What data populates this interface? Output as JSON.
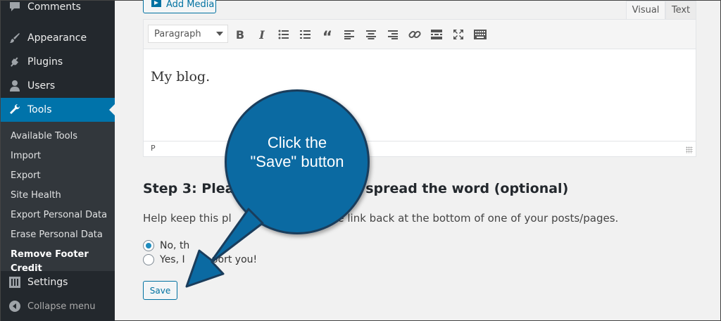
{
  "sidebar": {
    "items": [
      {
        "label": "Comments",
        "icon": "comment-icon"
      },
      {
        "label": "Appearance",
        "icon": "paintbrush-icon"
      },
      {
        "label": "Plugins",
        "icon": "plugin-icon"
      },
      {
        "label": "Users",
        "icon": "user-icon"
      },
      {
        "label": "Tools",
        "icon": "wrench-icon",
        "active": true
      },
      {
        "label": "Settings",
        "icon": "settings-icon"
      }
    ],
    "submenu": [
      "Available Tools",
      "Import",
      "Export",
      "Site Health",
      "Export Personal Data",
      "Erase Personal Data",
      "Remove Footer Credit"
    ],
    "collapse_label": "Collapse menu"
  },
  "editor": {
    "add_media_label": "Add Media",
    "tab_visual": "Visual",
    "tab_text": "Text",
    "format_value": "Paragraph",
    "content": "My blog.",
    "status_path": "P"
  },
  "step3": {
    "heading_left": "Step 3: Please",
    "heading_right": "and spread the word (optional)",
    "help_left": "Help keep this pl",
    "help_right": "one link back at the bottom of one of your posts/pages.",
    "option_no": "No, th",
    "option_yes_left": "Yes, I",
    "option_yes_right": "port you!",
    "save_label": "Save"
  },
  "callout": {
    "text": "Click the \"Save\" button"
  },
  "colors": {
    "sidebar_bg": "#23282d",
    "active_blue": "#0073aa",
    "callout_blue": "#0b6aa2"
  }
}
